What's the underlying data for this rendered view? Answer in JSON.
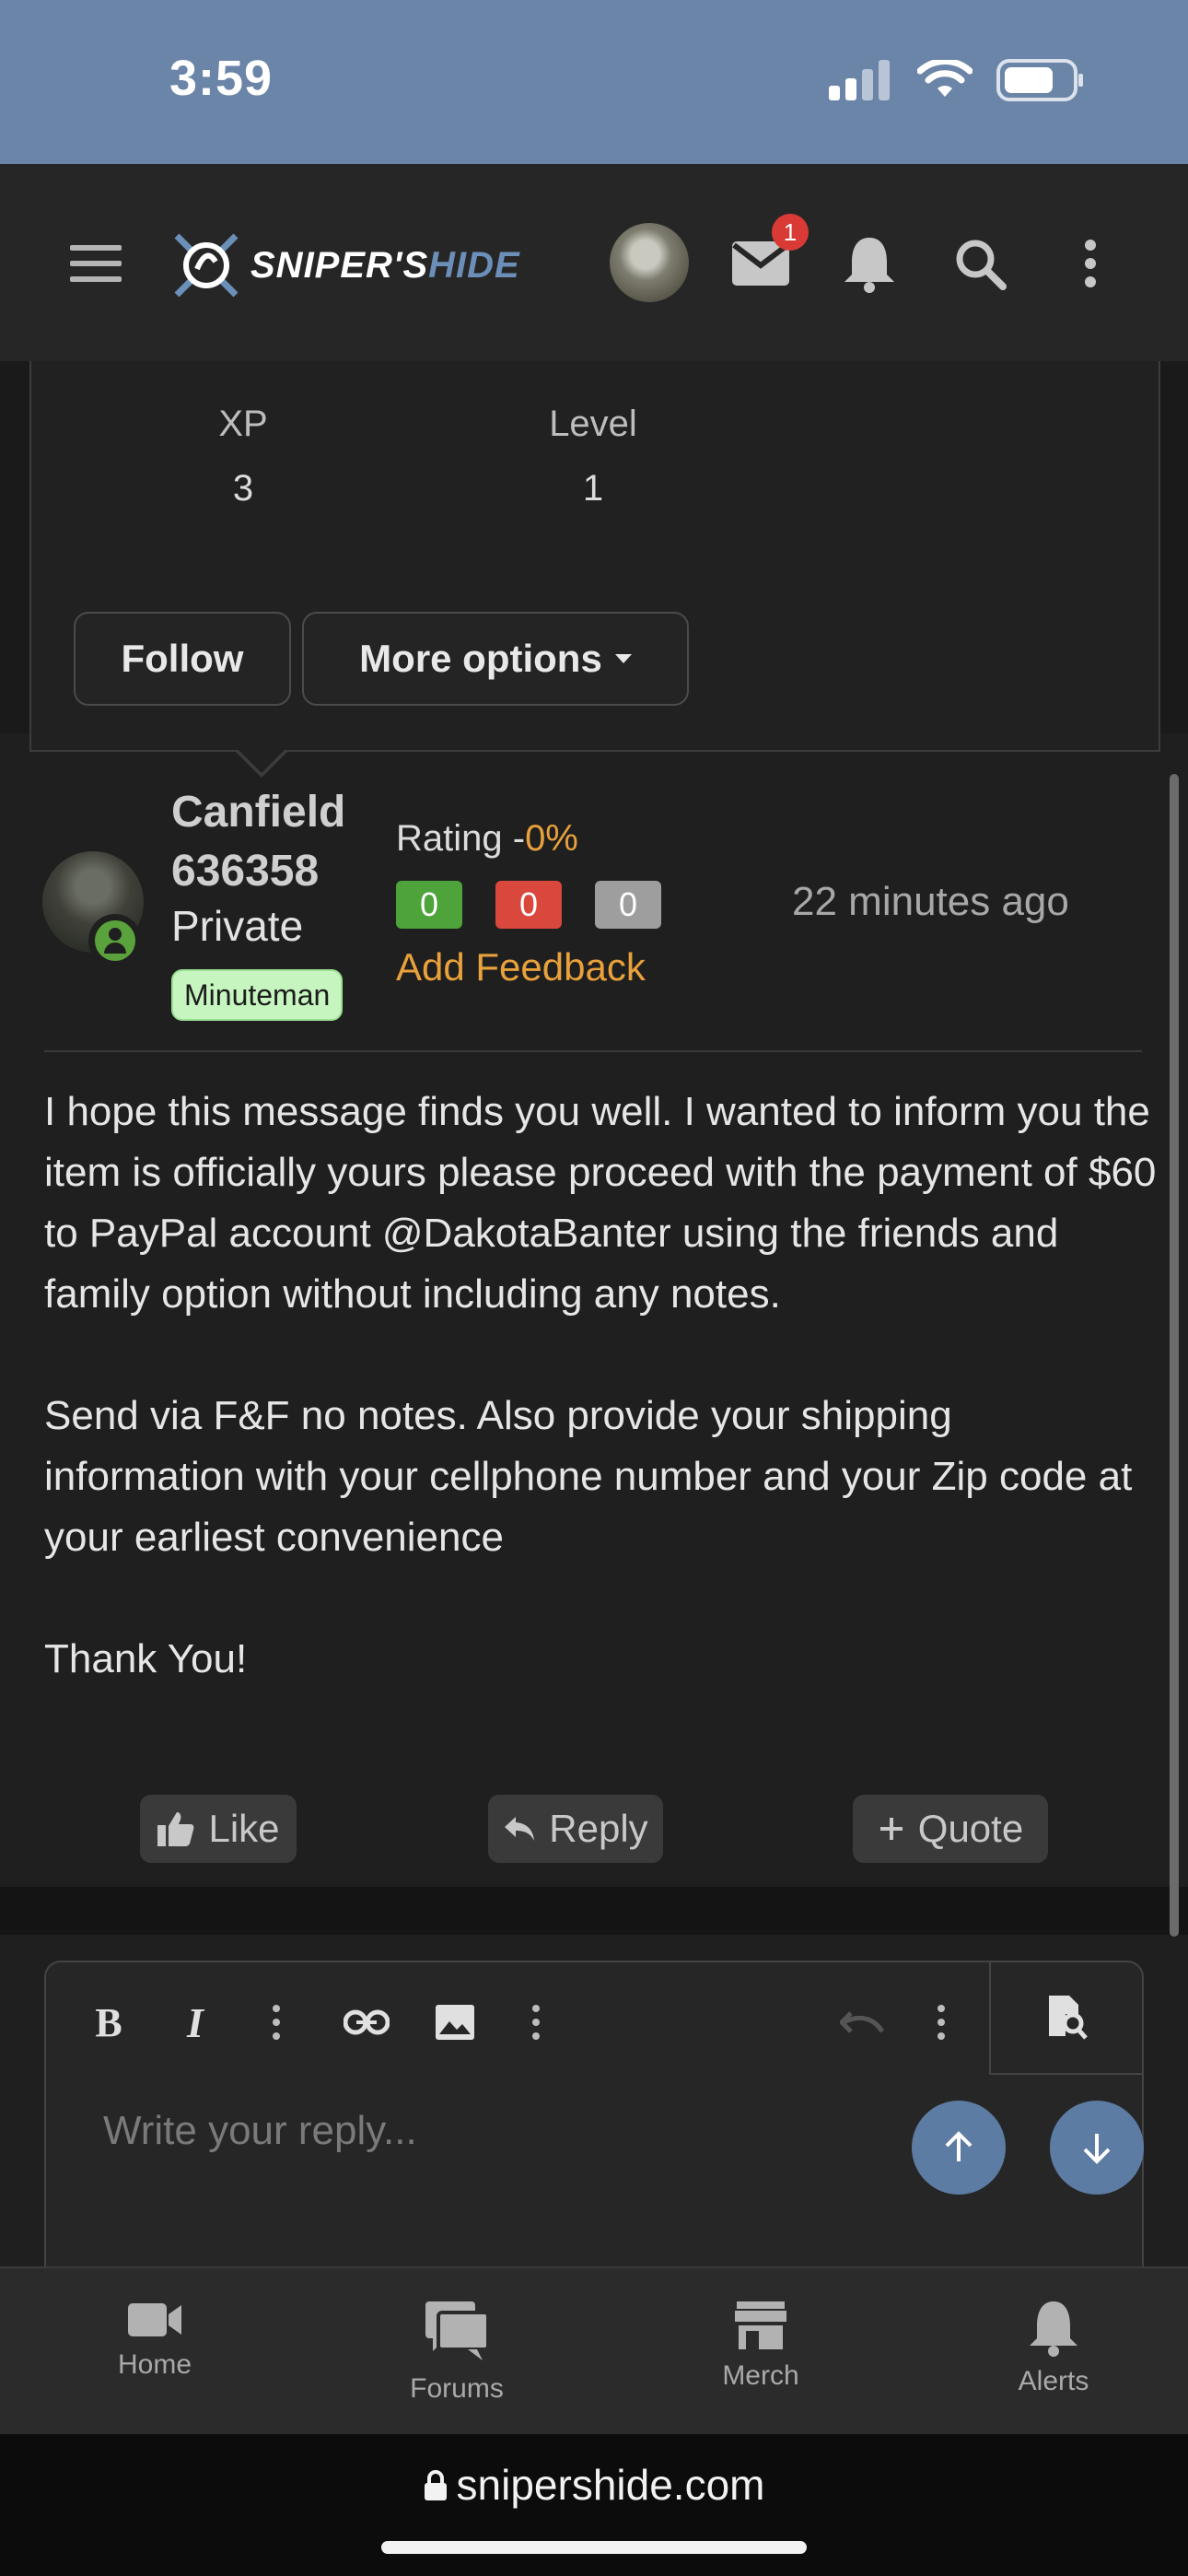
{
  "status_bar": {
    "time": "3:59"
  },
  "header": {
    "logo_main": "SNIPER'S",
    "logo_accent": "HIDE",
    "mail_badge_count": "1"
  },
  "profile_popup": {
    "stats": [
      {
        "label": "XP",
        "value": "3"
      },
      {
        "label": "Level",
        "value": "1"
      }
    ],
    "follow_label": "Follow",
    "more_options_label": "More options"
  },
  "post": {
    "username_line1": "Canfield",
    "username_line2": "636358",
    "rank": "Private",
    "badge": "Minuteman",
    "rating_label": "Rating -",
    "rating_percent": "0%",
    "feedback": [
      {
        "value": "0",
        "color": "#4ea33a"
      },
      {
        "value": "0",
        "color": "#d9473d"
      },
      {
        "value": "0",
        "color": "#9e9e9e"
      }
    ],
    "add_feedback": "Add Feedback",
    "timestamp": "22 minutes ago",
    "message": [
      "I hope this message finds you well. I wanted to inform you the item is officially yours please proceed with the payment of $60 to PayPal account @DakotaBanter using the friends and family option without including any notes.",
      "Send via F&F no notes. Also provide your shipping information with your cellphone number and your Zip code at your earliest convenience",
      "Thank You!"
    ],
    "actions": {
      "like": "Like",
      "reply": "Reply",
      "quote": "Quote"
    }
  },
  "editor": {
    "placeholder": "Write your reply..."
  },
  "tabbar": {
    "tabs": [
      {
        "label": "Home",
        "icon": "video-camera-icon"
      },
      {
        "label": "Forums",
        "icon": "chat-bubbles-icon"
      },
      {
        "label": "Merch",
        "icon": "store-icon"
      },
      {
        "label": "Alerts",
        "icon": "bell-icon"
      }
    ]
  },
  "browser": {
    "url": "snipershide.com"
  }
}
